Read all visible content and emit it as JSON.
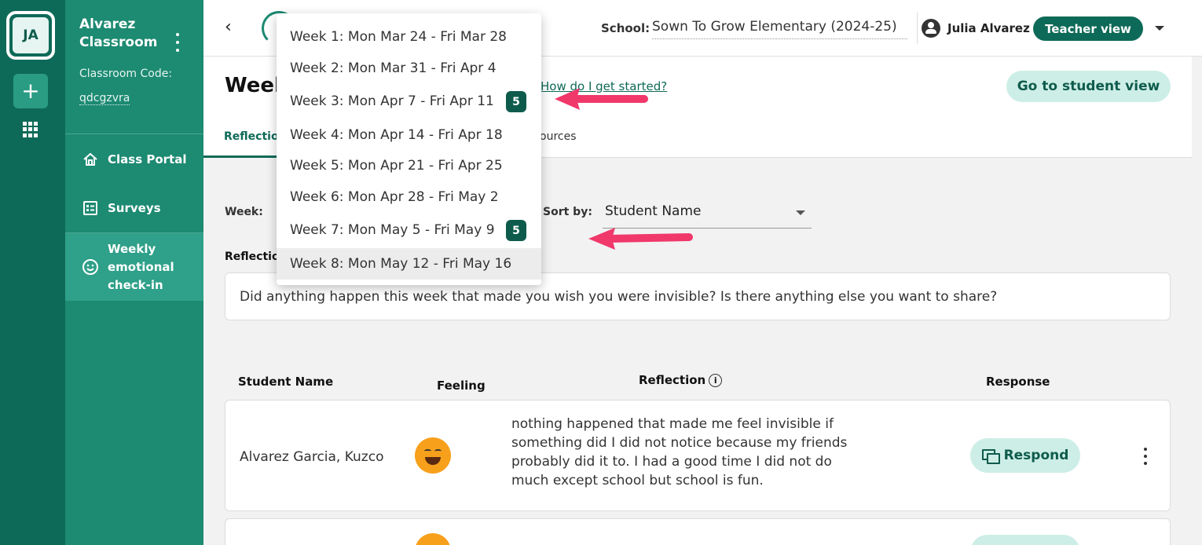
{
  "rail": {
    "avatar_initials": "JA",
    "add_label": "+"
  },
  "sidebar": {
    "classroom_name": "Alvarez Classroom",
    "classroom_code_label": "Classroom Code:",
    "classroom_code": "qdcgzvra",
    "nav": [
      {
        "label": "Class Portal",
        "icon": "home-icon"
      },
      {
        "label": "Surveys",
        "icon": "list-icon"
      },
      {
        "label": "Weekly emotional check-in",
        "icon": "smiley-icon",
        "active": true
      }
    ]
  },
  "topbar": {
    "school_label": "School:",
    "school_value": "Sown To Grow Elementary (2024-25)",
    "user_name": "Julia Alvarez",
    "role_pill": "Teacher view"
  },
  "header": {
    "title_partial": "Week",
    "help_link": "How do I get started?",
    "student_view_button": "Go to student view",
    "tabs": [
      {
        "label": "Reflection",
        "visible_text": "Reflectio",
        "active": true
      },
      {
        "label": "Resources",
        "visible_text": "ources"
      }
    ]
  },
  "filters": {
    "week_label": "Week:",
    "sort_label": "Sort by:",
    "sort_value": "Student Name",
    "reflection_label_partial": "Reflectio"
  },
  "question": "Did anything happen this week that made you wish you were invisible? Is there anything else you want to share?",
  "table": {
    "headers": {
      "student": "Student Name",
      "feeling": "Feeling",
      "reflection": "Reflection",
      "response": "Response"
    },
    "rows": [
      {
        "student": "Alvarez Garcia, Kuzco",
        "feeling": "happy",
        "reflection": "nothing happened that made me feel invisible if something did I did not notice because my friends probably did it to. I had a good time I did not do much except school but school is fun.",
        "respond_label": "Respond"
      }
    ]
  },
  "week_dropdown": {
    "options": [
      {
        "label": "Week 1: Mon Mar 24 - Fri Mar 28"
      },
      {
        "label": "Week 2: Mon Mar 31 - Fri Apr 4"
      },
      {
        "label": "Week 3: Mon Apr 7 - Fri Apr 11",
        "badge": "5"
      },
      {
        "label": "Week 4: Mon Apr 14 - Fri Apr 18"
      },
      {
        "label": "Week 5: Mon Apr 21 - Fri Apr 25"
      },
      {
        "label": "Week 6: Mon Apr 28 - Fri May 2"
      },
      {
        "label": "Week 7: Mon May 5 - Fri May 9",
        "badge": "5"
      },
      {
        "label": "Week 8: Mon May 12 - Fri May 16",
        "highlighted": true
      }
    ]
  },
  "colors": {
    "rail": "#0e6a58",
    "sidebar": "#1d8a72",
    "accent": "#0e5b4c",
    "button_light": "#cdeee6",
    "arrow": "#f0386b"
  }
}
